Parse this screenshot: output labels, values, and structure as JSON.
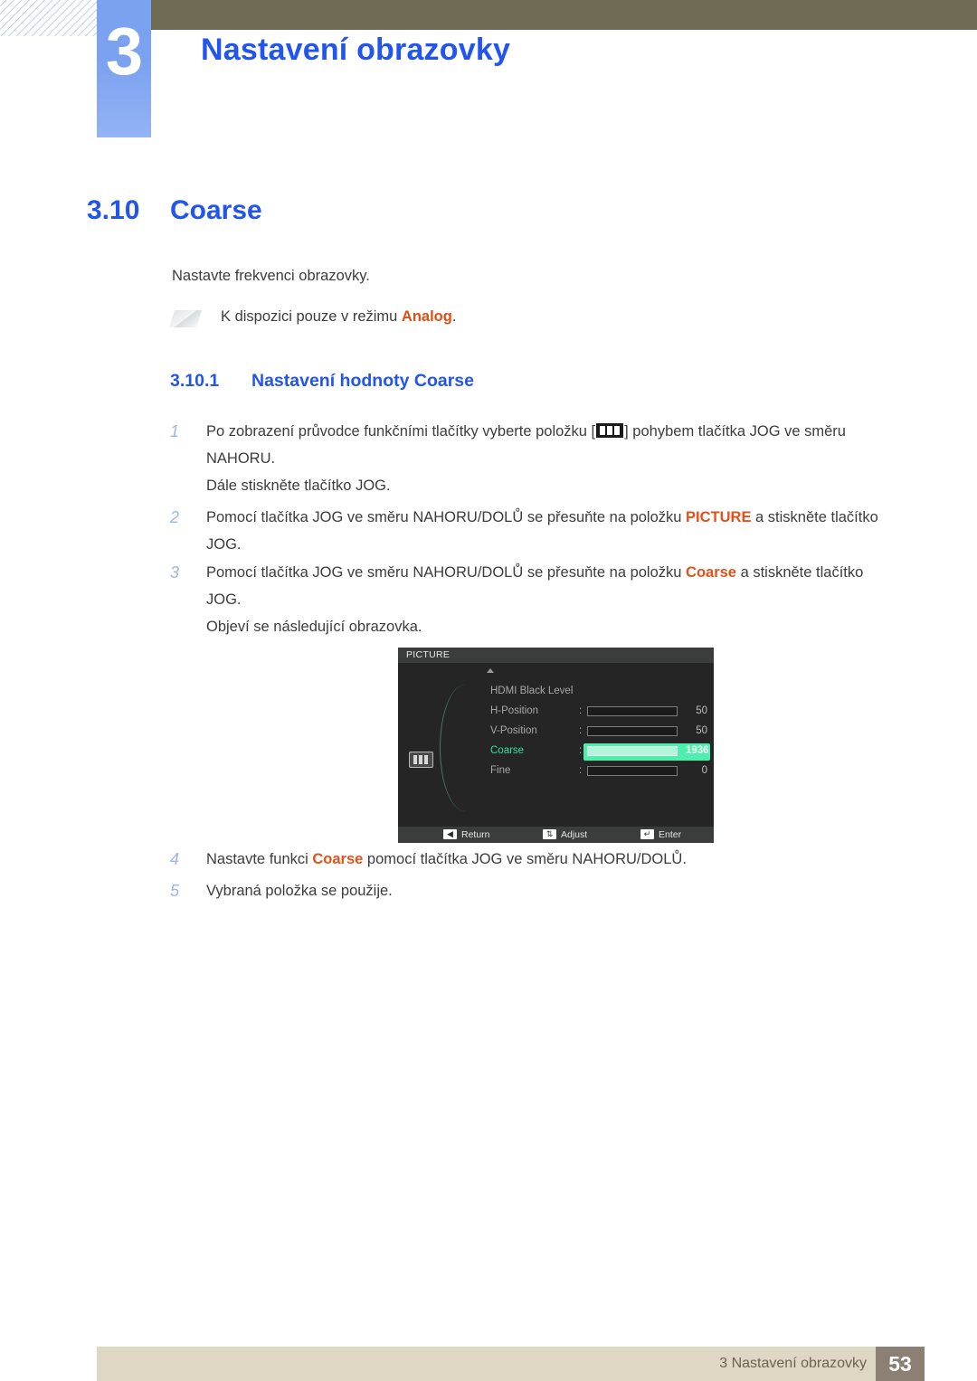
{
  "header": {
    "chapter_number": "3",
    "chapter_title": "Nastavení obrazovky"
  },
  "section": {
    "number": "3.10",
    "title": "Coarse",
    "intro": "Nastavte frekvenci obrazovky.",
    "note": "K dispozici pouze v režimu ",
    "note_highlight": "Analog",
    "note_tail": "."
  },
  "subsection": {
    "number": "3.10.1",
    "title": "Nastavení hodnoty Coarse"
  },
  "steps": [
    {
      "num": "1",
      "pre": "Po zobrazení průvodce funkčními tlačítky vyberte položku [",
      "post": "] pohybem tlačítka JOG ve směru NAHORU.",
      "extra": "Dále stiskněte tlačítko JOG."
    },
    {
      "num": "2",
      "pre": "Pomocí tlačítka JOG ve směru NAHORU/DOLŮ se přesuňte na položku ",
      "highlight": "PICTURE",
      "post": " a stiskněte tlačítko JOG."
    },
    {
      "num": "3",
      "pre": "Pomocí tlačítka JOG ve směru NAHORU/DOLŮ se přesuňte na položku ",
      "highlight": "Coarse",
      "post": " a stiskněte tlačítko JOG.",
      "extra": "Objeví se následující obrazovka."
    },
    {
      "num": "4",
      "pre": "Nastavte funkci ",
      "highlight": "Coarse",
      "post": " pomocí tlačítka JOG ve směru NAHORU/DOLŮ."
    },
    {
      "num": "5",
      "pre": "Vybraná položka se použije.",
      "highlight": "",
      "post": ""
    }
  ],
  "osd": {
    "title": "PICTURE",
    "rows": [
      {
        "label": "HDMI Black Level",
        "value": "",
        "has_bar": false,
        "fill_pct": 0,
        "active": false
      },
      {
        "label": "H-Position",
        "value": "50",
        "has_bar": true,
        "fill_pct": 56,
        "active": false
      },
      {
        "label": "V-Position",
        "value": "50",
        "has_bar": true,
        "fill_pct": 56,
        "active": false
      },
      {
        "label": "Coarse",
        "value": "1936",
        "has_bar": true,
        "fill_pct": 48,
        "active": true
      },
      {
        "label": "Fine",
        "value": "0",
        "has_bar": true,
        "fill_pct": 0,
        "active": false
      }
    ],
    "footer": [
      {
        "key": "◀",
        "label": "Return"
      },
      {
        "key": "⇅",
        "label": "Adjust"
      },
      {
        "key": "↵",
        "label": "Enter"
      }
    ],
    "colors": {
      "highlight": "#4cf0ad",
      "active_label": "#2fe39a",
      "background": "#252525"
    }
  },
  "footer": {
    "text": "3 Nastavení obrazovky",
    "page": "53"
  },
  "colors": {
    "heading_blue": "#2255ee",
    "accent_orange": "#dd4f16",
    "olive": "#6e6a54",
    "badge_blue": "#7ba2f0",
    "footer_bar": "#ddd7c4",
    "footer_page": "#8c7f73"
  }
}
